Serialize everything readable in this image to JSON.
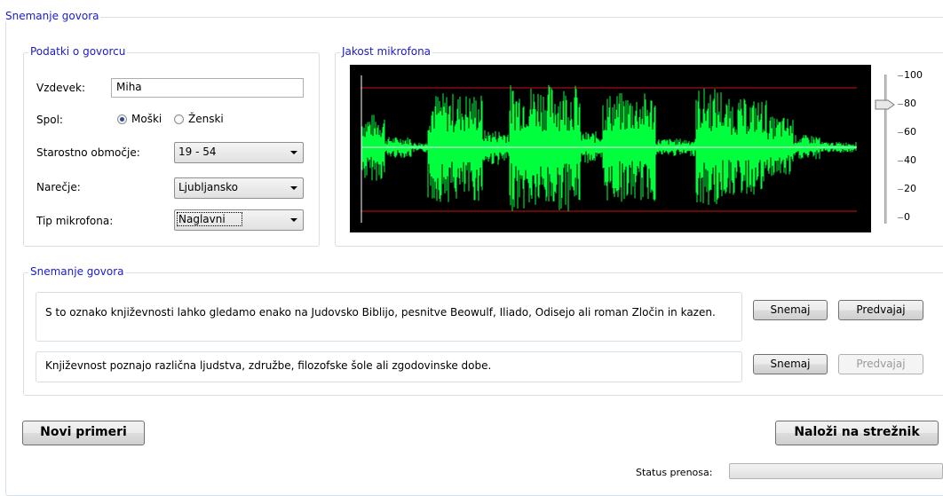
{
  "outer_group": {
    "title": "Snemanje govora"
  },
  "speaker_group": {
    "title": "Podatki o govorcu",
    "nickname_label": "Vzdevek:",
    "nickname_value": "Miha",
    "gender_label": "Spol:",
    "gender_options": [
      "Moški",
      "Ženski"
    ],
    "gender_selected": "Moški",
    "age_label": "Starostno območje:",
    "age_value": "19 - 54",
    "dialect_label": "Narečje:",
    "dialect_value": "Ljubljansko",
    "mic_label": "Tip mikrofona:",
    "mic_value": "Naglavni"
  },
  "mic_group": {
    "title": "Jakost mikrofona",
    "scale_ticks": [
      "100",
      "80",
      "60",
      "40",
      "20",
      "0"
    ],
    "slider_level": 80,
    "waveform_color": "#00ff3c",
    "threshold_color": "#d01010"
  },
  "recording_group": {
    "title": "Snemanje govora",
    "sentences": [
      {
        "text": "S to oznako književnosti lahko gledamo enako na Judovsko Biblijo, pesnitve Beowulf, Iliado, Odisejo ali roman Zločin in kazen.",
        "record_label": "Snemaj",
        "play_label": "Predvajaj",
        "play_enabled": true
      },
      {
        "text": "Književnost poznajo različna ljudstva, združbe, filozofske šole ali zgodovinske dobe.",
        "record_label": "Snemaj",
        "play_label": "Predvajaj",
        "play_enabled": false
      }
    ]
  },
  "actions": {
    "new_examples": "Novi primeri",
    "upload": "Naloži na strežnik"
  },
  "status": {
    "label": "Status prenosa:"
  }
}
